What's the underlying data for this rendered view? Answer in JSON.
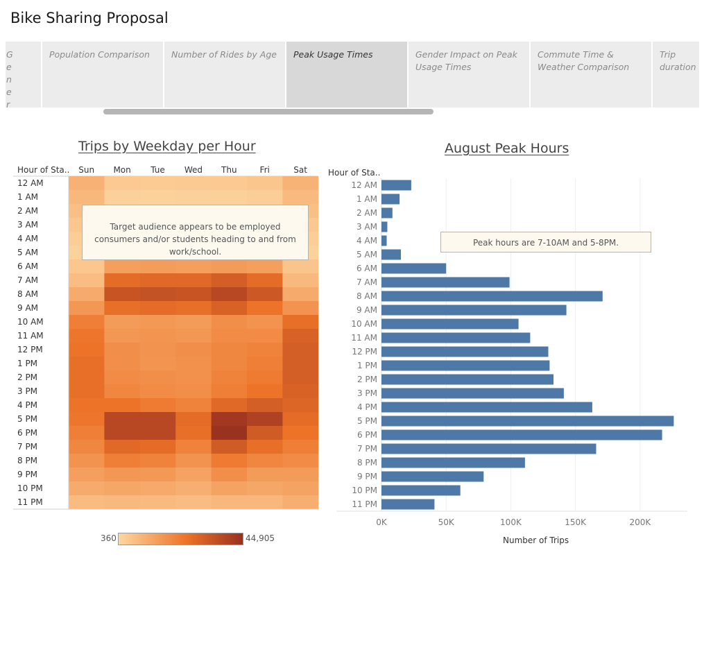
{
  "story": {
    "title": "Bike Sharing Proposal"
  },
  "tabs": [
    {
      "label": "Gener al Use r Infor matio..",
      "active": false
    },
    {
      "label": "Population Comparison",
      "active": false
    },
    {
      "label": "Number of Rides by Age",
      "active": false
    },
    {
      "label": "Peak Usage Times",
      "active": true
    },
    {
      "label": "Gender Impact on  Peak Usage Times",
      "active": false
    },
    {
      "label": "Commute Time & Weather Comparison",
      "active": false
    },
    {
      "label": "Trip duration",
      "active": false
    }
  ],
  "heatmap": {
    "title": "Trips by Weekday per Hour",
    "row_header": "Hour of Sta..",
    "annotation": "Target audience appears to be employed consumers and/or students heading to and from work/school.",
    "legend": {
      "min": "360",
      "max": "44,905"
    }
  },
  "bars": {
    "title": "August Peak Hours",
    "row_header": "Hour of Sta..",
    "annotation": "Peak hours are 7-10AM and 5-8PM.",
    "xlabel": "Number of Trips",
    "x_ticks": [
      "0K",
      "50K",
      "100K",
      "150K",
      "200K"
    ]
  },
  "colors": {
    "bar": "#4e79a7",
    "heat_low": "#fdd6a1",
    "heat_mid": "#ed7328",
    "heat_high": "#9a3220"
  },
  "chart_data": [
    {
      "type": "heatmap",
      "title": "Trips by Weekday per Hour",
      "ylabel": "Hour of Sta..",
      "columns": [
        "Sun",
        "Mon",
        "Tue",
        "Wed",
        "Thu",
        "Fri",
        "Sat"
      ],
      "rows": [
        "12 AM",
        "1 AM",
        "2 AM",
        "3 AM",
        "4 AM",
        "5 AM",
        "6 AM",
        "7 AM",
        "8 AM",
        "9 AM",
        "10 AM",
        "11 AM",
        "12 PM",
        "1 PM",
        "2 PM",
        "3 PM",
        "4 PM",
        "5 PM",
        "6 PM",
        "7 PM",
        "8 PM",
        "9 PM",
        "10 PM",
        "11 PM"
      ],
      "color_range": [
        360,
        44905
      ],
      "values": [
        [
          9500,
          3500,
          3200,
          3400,
          3600,
          4200,
          9000
        ],
        [
          7800,
          1800,
          1700,
          1800,
          1900,
          2300,
          7400
        ],
        [
          6000,
          1000,
          900,
          950,
          1000,
          1300,
          5800
        ],
        [
          4000,
          700,
          650,
          700,
          720,
          900,
          3900
        ],
        [
          2600,
          600,
          550,
          580,
          600,
          700,
          2500
        ],
        [
          1400,
          1800,
          1700,
          1750,
          1800,
          1700,
          1300
        ],
        [
          4000,
          14000,
          14500,
          14000,
          15000,
          14000,
          4500
        ],
        [
          6500,
          27000,
          28000,
          28000,
          31000,
          27000,
          7500
        ],
        [
          11000,
          34000,
          35000,
          34000,
          38000,
          33000,
          11000
        ],
        [
          16000,
          26000,
          27000,
          26000,
          30000,
          25000,
          17000
        ],
        [
          22000,
          15000,
          15500,
          15000,
          18000,
          17000,
          26000
        ],
        [
          24000,
          16000,
          16500,
          16000,
          19000,
          19000,
          30000
        ],
        [
          25000,
          18000,
          17000,
          18000,
          20000,
          21000,
          31000
        ],
        [
          26000,
          18000,
          16500,
          17500,
          20000,
          22000,
          31000
        ],
        [
          26000,
          19000,
          18000,
          17500,
          21000,
          23000,
          31000
        ],
        [
          26000,
          20000,
          19000,
          18000,
          22000,
          25000,
          30000
        ],
        [
          25000,
          25000,
          23000,
          21000,
          28000,
          31000,
          29000
        ],
        [
          24000,
          38000,
          38000,
          27000,
          43000,
          40000,
          27000
        ],
        [
          22000,
          38000,
          38000,
          26000,
          44905,
          32000,
          25000
        ],
        [
          20000,
          28000,
          27000,
          21000,
          32000,
          26000,
          22000
        ],
        [
          17000,
          22000,
          21000,
          17000,
          23000,
          20000,
          19000
        ],
        [
          14000,
          16000,
          15500,
          13000,
          18000,
          15000,
          15000
        ],
        [
          11000,
          12000,
          11500,
          10000,
          13000,
          12000,
          13000
        ],
        [
          7000,
          7500,
          7200,
          6500,
          8000,
          8000,
          10000
        ]
      ]
    },
    {
      "type": "bar",
      "orientation": "horizontal",
      "title": "August Peak Hours",
      "ylabel": "Hour of Sta..",
      "xlabel": "Number of Trips",
      "categories": [
        "12 AM",
        "1 AM",
        "2 AM",
        "3 AM",
        "4 AM",
        "5 AM",
        "6 AM",
        "7 AM",
        "8 AM",
        "9 AM",
        "10 AM",
        "11 AM",
        "12 PM",
        "1 PM",
        "2 PM",
        "3 PM",
        "4 PM",
        "5 PM",
        "6 PM",
        "7 PM",
        "8 PM",
        "9 PM",
        "10 PM",
        "11 PM"
      ],
      "values": [
        23000,
        14000,
        8500,
        4500,
        4000,
        15000,
        50000,
        99000,
        171000,
        143000,
        106000,
        115000,
        129000,
        130000,
        133000,
        141000,
        163000,
        226000,
        217000,
        166000,
        111000,
        79000,
        61000,
        41000
      ],
      "xlim": [
        0,
        236000
      ],
      "grid": true
    }
  ]
}
